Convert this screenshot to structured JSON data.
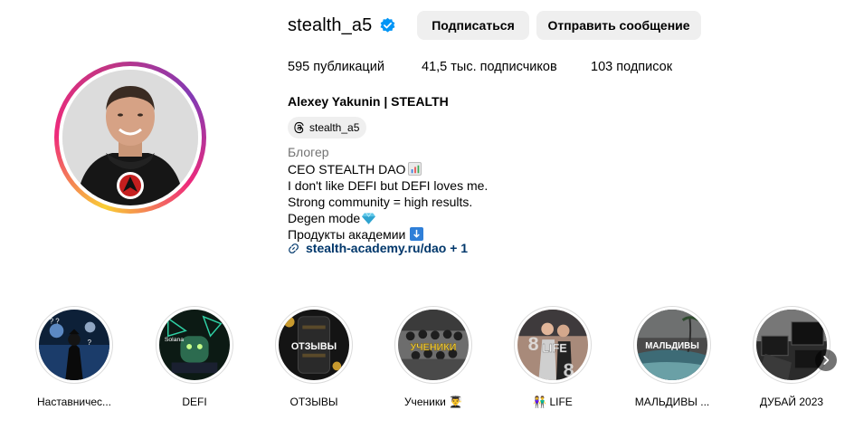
{
  "profile": {
    "username": "stealth_a5",
    "verified": true,
    "follow_label": "Подписаться",
    "message_label": "Отправить сообщение",
    "stats": {
      "posts": "595 публикаций",
      "followers": "41,5 тыс. подписчиков",
      "following": "103 подписок"
    },
    "full_name": "Alexey Yakunin | STEALTH",
    "threads_handle": "stealth_a5",
    "category": "Блогер",
    "bio": {
      "line1": "CEO STEALTH DAO",
      "line2": "I don't like DEFI but DEFI loves me.",
      "line3": "Strong community = high results.",
      "line4": "Degen mode",
      "line5": "Продукты академии"
    },
    "link": "stealth-academy.ru/dao + 1"
  },
  "highlights": [
    {
      "label": "Наставничес...",
      "icon": "mentoring-cover"
    },
    {
      "label": "DEFI",
      "icon": "defi-cover"
    },
    {
      "label": "ОТЗЫВЫ",
      "cover_text": "ОТЗЫВЫ"
    },
    {
      "label": "Ученики 👨‍🎓",
      "cover_text": "УЧЕНИКИ"
    },
    {
      "label": "👫 LIFE",
      "cover_text": "LIFE"
    },
    {
      "label": "МАЛЬДИВЫ ...",
      "cover_text": "МАЛЬДИВЫ"
    },
    {
      "label": "ДУБАЙ 2023",
      "icon": "dubai-cover"
    }
  ],
  "colors": {
    "verified": "#0095f6",
    "link": "#00376b",
    "button_bg": "#efefef",
    "muted": "#737373"
  }
}
